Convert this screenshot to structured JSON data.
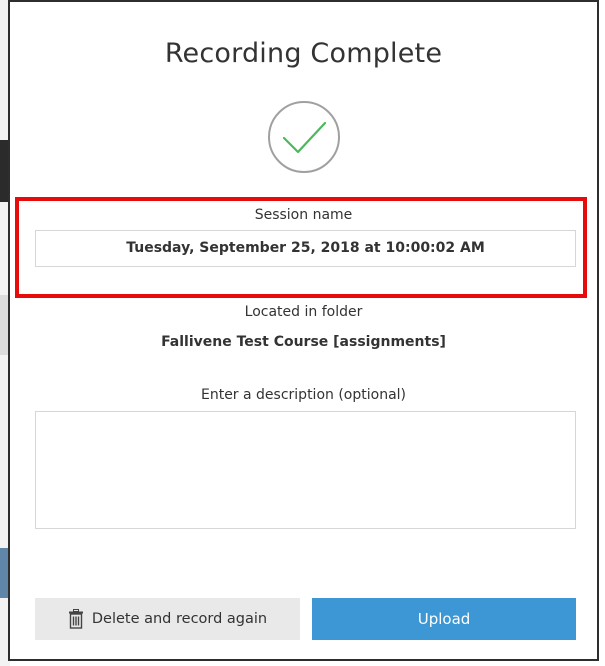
{
  "dialog": {
    "title": "Recording Complete",
    "icon": "check-circle-icon",
    "session": {
      "label": "Session name",
      "value": "Tuesday, September 25, 2018 at 10:00:02 AM"
    },
    "folder": {
      "label": "Located in folder",
      "name": "Fallivene Test Course [assignments]"
    },
    "description": {
      "label": "Enter a description (optional)",
      "value": "",
      "placeholder": ""
    },
    "buttons": {
      "delete_label": "Delete and record again",
      "delete_icon": "trash-icon",
      "upload_label": "Upload"
    }
  },
  "colors": {
    "highlight_border": "#e80b0b",
    "upload_button": "#3d97d4",
    "delete_button": "#e9e9e9",
    "checkmark": "#4cb85c"
  }
}
